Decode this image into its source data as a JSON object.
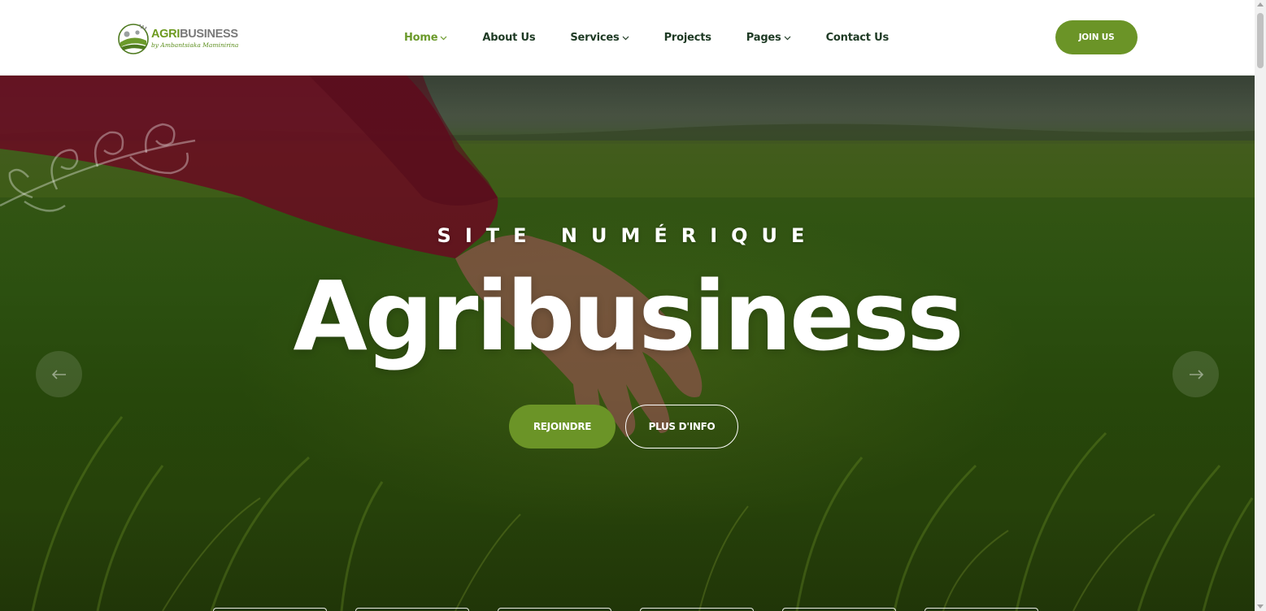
{
  "header": {
    "logo": {
      "title_a": "AGRI",
      "title_b": "BUSINESS",
      "subtitle": "by Ambantsiaka Maminirina"
    },
    "nav": [
      {
        "label": "Home",
        "has_dropdown": true,
        "active": true
      },
      {
        "label": "About Us",
        "has_dropdown": false,
        "active": false
      },
      {
        "label": "Services",
        "has_dropdown": true,
        "active": false
      },
      {
        "label": "Projects",
        "has_dropdown": false,
        "active": false
      },
      {
        "label": "Pages",
        "has_dropdown": true,
        "active": false
      },
      {
        "label": "Contact Us",
        "has_dropdown": false,
        "active": false
      }
    ],
    "join_label": "JOIN US"
  },
  "hero": {
    "eyebrow": "SITE NUMÉRIQUE",
    "title": "Agribusiness",
    "primary_button": "REJOINDRE",
    "secondary_button": "PLUS D'INFO",
    "prev_icon": "arrow-left-icon",
    "next_icon": "arrow-right-icon"
  },
  "colors": {
    "brand_green": "#6b9427",
    "nav_active": "#6b9a2b",
    "nav_text": "#1e3a24"
  }
}
